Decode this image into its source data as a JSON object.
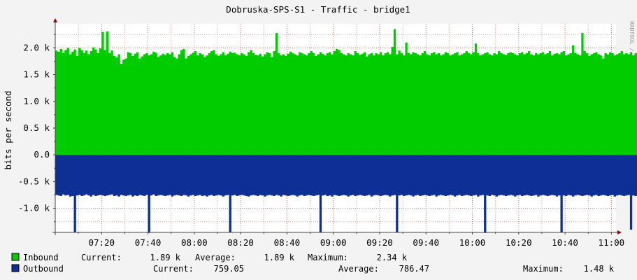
{
  "chart_data": {
    "type": "area",
    "title": "Dobruska-SPS-S1 - Traffic - bridge1",
    "ylabel": "bits per second",
    "watermark": "RRDTOOL / TOBI OETIKER",
    "ylim": [
      -1450,
      2450
    ],
    "y_ticks": [
      {
        "value": 2000,
        "label": "2.0 k"
      },
      {
        "value": 1500,
        "label": "1.5 k"
      },
      {
        "value": 1000,
        "label": "1.0 k"
      },
      {
        "value": 500,
        "label": "0.5 k"
      },
      {
        "value": 0,
        "label": "0.0"
      },
      {
        "value": -500,
        "label": "-0.5 k"
      },
      {
        "value": -1000,
        "label": "-1.0 k"
      }
    ],
    "x_range": [
      "07:00",
      "11:02"
    ],
    "x_ticks": [
      "07:20",
      "07:40",
      "08:00",
      "08:20",
      "08:40",
      "09:00",
      "09:20",
      "09:40",
      "10:00",
      "10:20",
      "10:40",
      "11:00"
    ],
    "grid": true,
    "colors": {
      "inbound": "#00cc00",
      "outbound": "#0d2f96",
      "grid_minor": "#e0a0a0",
      "grid_major": "#c87070",
      "axis": "#444444",
      "arrow": "#990000",
      "background": "#ffffff",
      "page": "#f3f3f3"
    },
    "series": [
      {
        "name": "Inbound",
        "x_start": "07:00",
        "x_step_min": 1,
        "values": [
          1950,
          1930,
          1980,
          1900,
          1960,
          2000,
          1880,
          1930,
          1970,
          1850,
          2000,
          1960,
          1900,
          1950,
          1880,
          1940,
          2010,
          1970,
          1900,
          1990,
          2300,
          1960,
          2310,
          1900,
          1950,
          1850,
          1820,
          1880,
          1700,
          1780,
          1800,
          1920,
          1900,
          1850,
          1890,
          1920,
          1800,
          1840,
          1880,
          1900,
          1860,
          1880,
          1930,
          1910,
          1830,
          1860,
          1890,
          1870,
          1900,
          1880,
          1920,
          1830,
          1800,
          1880,
          1960,
          1980,
          1800,
          1850,
          1880,
          1910,
          1940,
          1860,
          1900,
          1880,
          1830,
          1860,
          1900,
          1940,
          1960,
          1880,
          1850,
          1880,
          1920,
          1860,
          1890,
          1930,
          1900,
          1910,
          1880,
          1860,
          1900,
          1880,
          1850,
          1920,
          1960,
          1900,
          1870,
          1860,
          1890,
          1840,
          1880,
          1920,
          1900,
          1830,
          1940,
          2280,
          1900,
          1860,
          1880,
          1850,
          1890,
          1930,
          1900,
          1880,
          1860,
          1920,
          1900,
          1880,
          1860,
          1900,
          1940,
          1900,
          1850,
          1880,
          1920,
          1890,
          1860,
          1900,
          1920,
          1880,
          1940,
          1980,
          1960,
          1900,
          1880,
          1860,
          1900,
          1880,
          1860,
          1940,
          1900,
          1870,
          1890,
          1920,
          1840,
          1880,
          1900,
          1860,
          1900,
          1880,
          1920,
          1860,
          1900,
          1920,
          1880,
          2020,
          2350,
          1880,
          1950,
          1900,
          1860,
          2100,
          1900,
          1880,
          1920,
          1900,
          1880,
          1860,
          1900,
          1940,
          1880,
          1860,
          1900,
          1920,
          1880,
          1900,
          1860,
          1880,
          1920,
          1900,
          1860,
          1880,
          1900,
          1920,
          1860,
          1880,
          1900,
          1940,
          1900,
          1880,
          1920,
          2080,
          1900,
          1860,
          1880,
          1900,
          1920,
          1880,
          1860,
          1900,
          1880,
          1940,
          1900,
          1880,
          1870,
          1900,
          1920,
          1900,
          1880,
          1860,
          1900,
          1920,
          1880,
          1900,
          1940,
          1880,
          1860,
          1900,
          1880,
          1900,
          1920,
          1880,
          1900,
          1940,
          1860,
          1890,
          1900,
          1880,
          1920,
          1940,
          1860,
          1880,
          1900,
          2050,
          1900,
          1880,
          1860,
          2280,
          1940,
          1900,
          1850,
          1880,
          1900,
          1920,
          1880,
          1860,
          1800,
          1900,
          1880,
          1920,
          1900,
          1860,
          1880,
          1900,
          1940,
          1880,
          1900,
          1880,
          1920,
          1860,
          1900,
          1880,
          1900,
          1940,
          1960,
          1880,
          1900,
          1860,
          1880,
          1920,
          1900,
          1860,
          1880,
          1900,
          1920,
          1900,
          1880,
          1860,
          1900,
          1890,
          1880,
          1900,
          1860,
          1880,
          1900,
          1920,
          1880,
          1900
        ]
      },
      {
        "name": "Outbound",
        "x_start": "07:00",
        "x_step_min": 1,
        "values": [
          -750,
          -760,
          -770,
          -740,
          -760,
          -750,
          -780,
          -770,
          -1450,
          -760,
          -750,
          -770,
          -760,
          -740,
          -760,
          -780,
          -750,
          -770,
          -760,
          -750,
          -760,
          -770,
          -760,
          -750,
          -740,
          -770,
          -760,
          -780,
          -750,
          -760,
          -770,
          -760,
          -750,
          -780,
          -760,
          -770,
          -750,
          -760,
          -770,
          -750,
          -1460,
          -760,
          -740,
          -770,
          -760,
          -750,
          -760,
          -770,
          -760,
          -750,
          -780,
          -760,
          -750,
          -760,
          -770,
          -750,
          -760,
          -780,
          -760,
          -750,
          -770,
          -760,
          -750,
          -770,
          -760,
          -780,
          -760,
          -750,
          -770,
          -760,
          -750,
          -760,
          -780,
          -760,
          -750,
          -1450,
          -760,
          -750,
          -770,
          -760,
          -750,
          -760,
          -770,
          -780,
          -760,
          -750,
          -760,
          -770,
          -750,
          -760,
          -780,
          -760,
          -750,
          -760,
          -770,
          -750,
          -760,
          -780,
          -750,
          -760,
          -770,
          -760,
          -750,
          -760,
          -780,
          -760,
          -750,
          -770,
          -760,
          -750,
          -760,
          -770,
          -760,
          -750,
          -1450,
          -760,
          -750,
          -770,
          -760,
          -780,
          -750,
          -760,
          -770,
          -760,
          -750,
          -760,
          -780,
          -760,
          -750,
          -770,
          -760,
          -750,
          -760,
          -770,
          -760,
          -750,
          -780,
          -760,
          -750,
          -760,
          -770,
          -760,
          -750,
          -760,
          -780,
          -760,
          -750,
          -1450,
          -760,
          -750,
          -770,
          -760,
          -750,
          -760,
          -780,
          -760,
          -750,
          -770,
          -760,
          -750,
          -760,
          -770,
          -760,
          -750,
          -780,
          -760,
          -750,
          -760,
          -770,
          -760,
          -750,
          -760,
          -780,
          -760,
          -750,
          -770,
          -760,
          -750,
          -760,
          -770,
          -760,
          -750,
          -780,
          -760,
          -750,
          -1460,
          -760,
          -770,
          -750,
          -760,
          -780,
          -760,
          -750,
          -760,
          -770,
          -760,
          -750,
          -760,
          -780,
          -760,
          -750,
          -770,
          -760,
          -750,
          -760,
          -770,
          -760,
          -750,
          -780,
          -760,
          -750,
          -760,
          -770,
          -760,
          -750,
          -760,
          -780,
          -760,
          -1450,
          -760,
          -770,
          -750,
          -760,
          -780,
          -760,
          -750,
          -760,
          -770,
          -760,
          -750,
          -760,
          -780,
          -760,
          -750,
          -770,
          -760,
          -750,
          -760,
          -770,
          -760,
          -750,
          -780,
          -760,
          -750,
          -760,
          -770,
          -760,
          -750,
          -1400,
          -760,
          -770,
          -750,
          -760,
          -780,
          -760,
          -750,
          -760,
          -770,
          -760,
          -750,
          -760,
          -780,
          -760,
          -750,
          -770,
          -760,
          -750,
          -760,
          -770,
          -760,
          -750,
          -760,
          -780
        ]
      }
    ]
  },
  "legend": {
    "inbound": {
      "name": "Inbound",
      "current_label": "Current:",
      "current": "1.89 k",
      "average_label": "Average:",
      "average": "1.89 k",
      "maximum_label": "Maximum:",
      "maximum": "2.34 k"
    },
    "outbound": {
      "name": "Outbound",
      "current_label": "Current:",
      "current": "759.05",
      "average_label": "Average:",
      "average": "786.47",
      "maximum_label": "Maximum:",
      "maximum": "1.48 k"
    }
  }
}
